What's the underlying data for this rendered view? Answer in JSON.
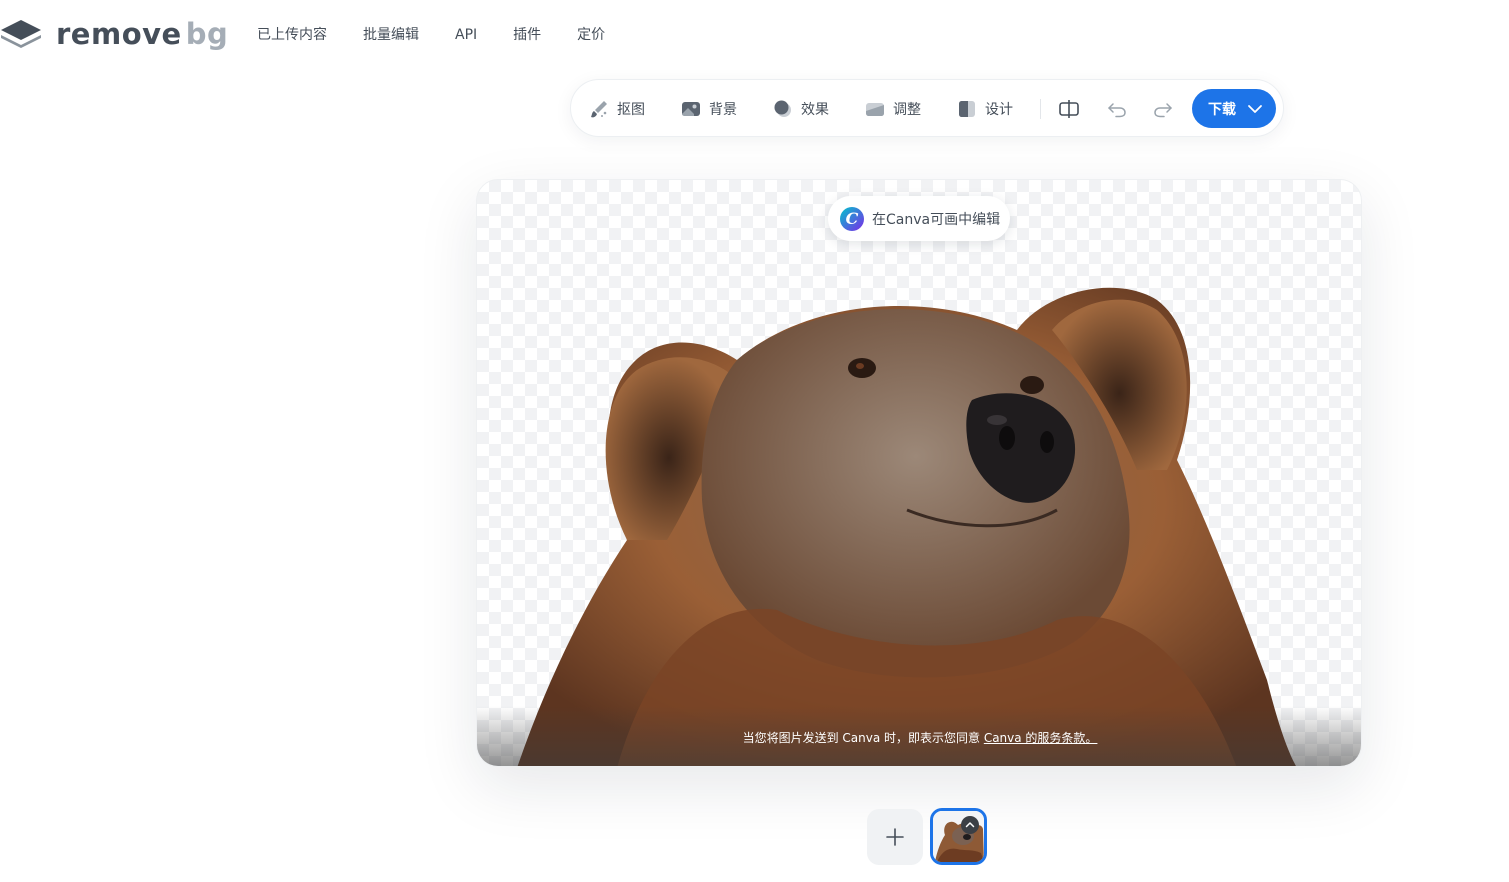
{
  "brand": {
    "name_main": "remove",
    "name_suffix": "bg"
  },
  "nav": {
    "items": [
      {
        "label": "已上传内容"
      },
      {
        "label": "批量编辑"
      },
      {
        "label": "API"
      },
      {
        "label": "插件"
      },
      {
        "label": "定价"
      }
    ]
  },
  "toolbar": {
    "tools": [
      {
        "label": "抠图",
        "icon": "brush-icon"
      },
      {
        "label": "背景",
        "icon": "image-icon"
      },
      {
        "label": "效果",
        "icon": "effects-icon"
      },
      {
        "label": "调整",
        "icon": "adjust-icon"
      },
      {
        "label": "设计",
        "icon": "design-icon"
      }
    ],
    "compare_icon": "compare-icon",
    "undo_icon": "undo-icon",
    "redo_icon": "redo-icon",
    "download_label": "下载"
  },
  "editor": {
    "canva_button_label": "在Canva可画中编辑",
    "terms_text": "当您将图片发送到 Canva 时，即表示您同意 ",
    "terms_link": "Canva 的服务条款。"
  },
  "colors": {
    "accent": "#1d74e8",
    "text": "#454e59",
    "logo_secondary": "#a5adb6"
  }
}
